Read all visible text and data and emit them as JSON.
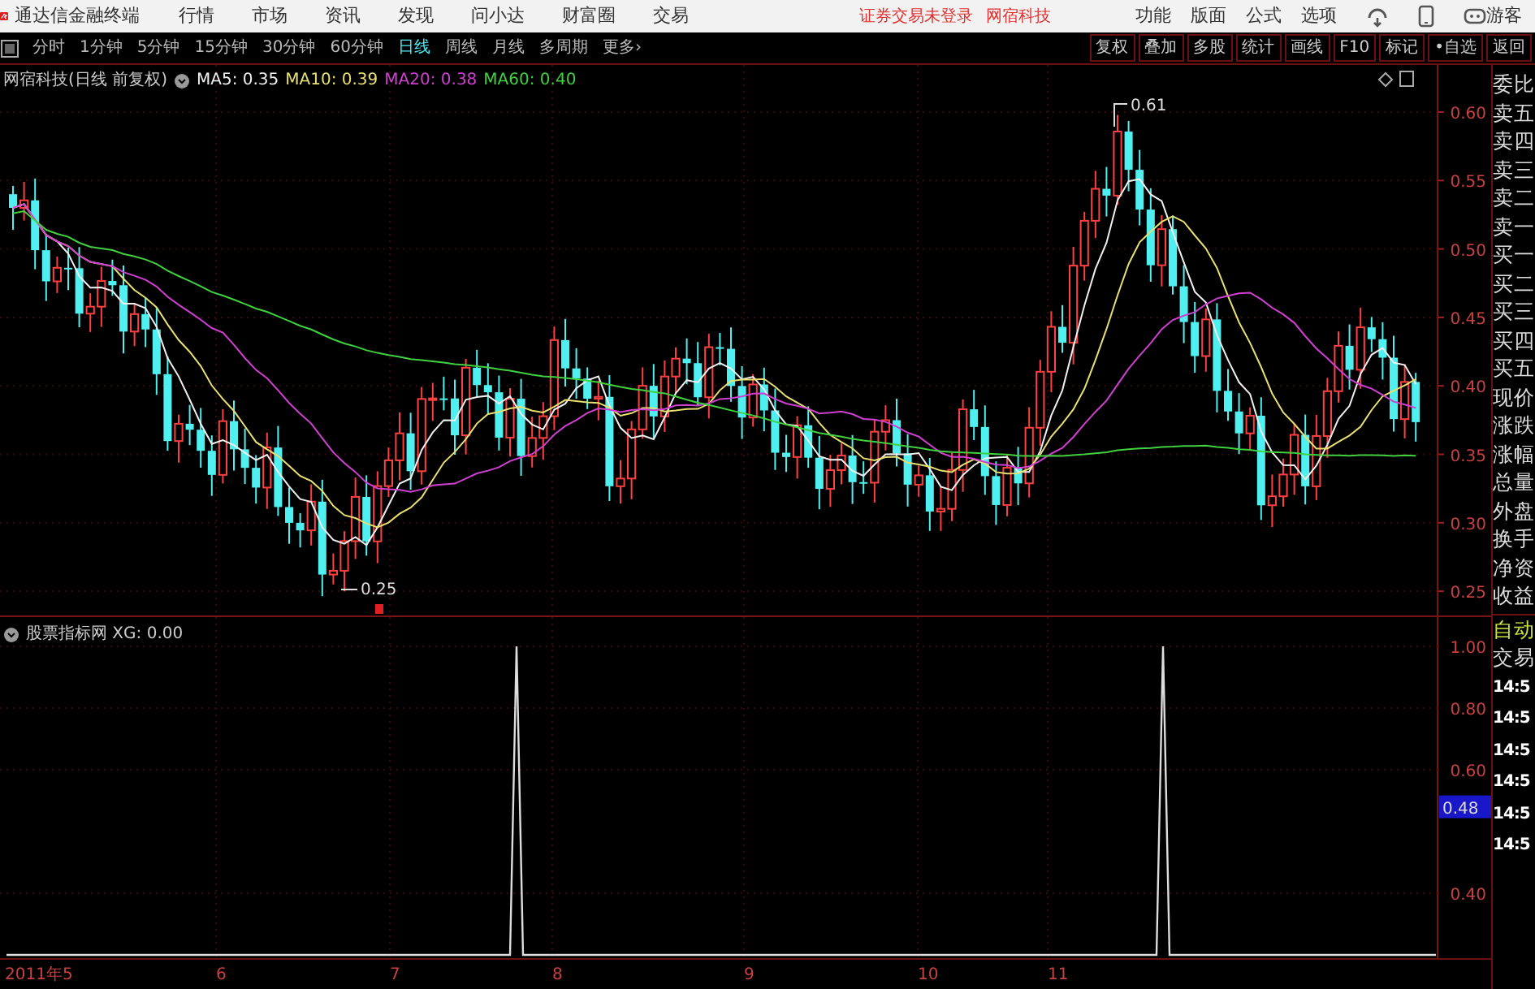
{
  "app_bar": {
    "title": "通达信金融终端",
    "menus": [
      "行情",
      "市场",
      "资讯",
      "发现",
      "问小达",
      "财富圈",
      "交易"
    ],
    "notices": [
      "证券交易未登录",
      "网宿科技"
    ],
    "tools": [
      "功能",
      "版面",
      "公式",
      "选项"
    ],
    "user": "游客"
  },
  "period_bar": {
    "periods": [
      {
        "label": "分时",
        "selected": false
      },
      {
        "label": "1分钟",
        "selected": false
      },
      {
        "label": "5分钟",
        "selected": false
      },
      {
        "label": "15分钟",
        "selected": false
      },
      {
        "label": "30分钟",
        "selected": false
      },
      {
        "label": "60分钟",
        "selected": false
      },
      {
        "label": "日线",
        "selected": true
      },
      {
        "label": "周线",
        "selected": false
      },
      {
        "label": "月线",
        "selected": false
      },
      {
        "label": "多周期",
        "selected": false
      },
      {
        "label": "更多›",
        "selected": false
      }
    ],
    "buttons": [
      "复权",
      "叠加",
      "多股",
      "统计",
      "画线",
      "F10",
      "标记",
      "•自选",
      "返回"
    ]
  },
  "price_chart": {
    "title": "网宿科技(日线 前复权)",
    "legend": [
      {
        "label": "MA5: 0.35",
        "color": "#f0f0f0"
      },
      {
        "label": "MA10: 0.39",
        "color": "#e8e070"
      },
      {
        "label": "MA20: 0.38",
        "color": "#d040d0"
      },
      {
        "label": "MA60: 0.40",
        "color": "#40d040"
      }
    ],
    "yticks": [
      "0.60",
      "0.55",
      "0.50",
      "0.45",
      "0.40",
      "0.35",
      "0.30",
      "0.25"
    ],
    "high_label": "0.61",
    "low_label": "0.25"
  },
  "indicator_chart": {
    "title": "股票指标网 XG: 0.00",
    "yticks": [
      "1.00",
      "0.80",
      "0.60",
      "0.40"
    ],
    "current_value": "0.48"
  },
  "x_axis": [
    "2011年5",
    "6",
    "7",
    "8",
    "9",
    "10",
    "11"
  ],
  "quote_panel": {
    "fields": [
      "委比",
      "卖五",
      "卖四",
      "卖三",
      "卖二",
      "卖一",
      "买一",
      "买二",
      "买三",
      "买四",
      "买五",
      "现价",
      "涨跌",
      "涨幅",
      "总量",
      "外盘",
      "换手",
      "净资",
      "收益"
    ],
    "auto_label": "自动",
    "trade_label": "交易",
    "times": [
      "14:5",
      "14:5",
      "14:5",
      "14:5",
      "14:5",
      "14:5"
    ]
  }
}
